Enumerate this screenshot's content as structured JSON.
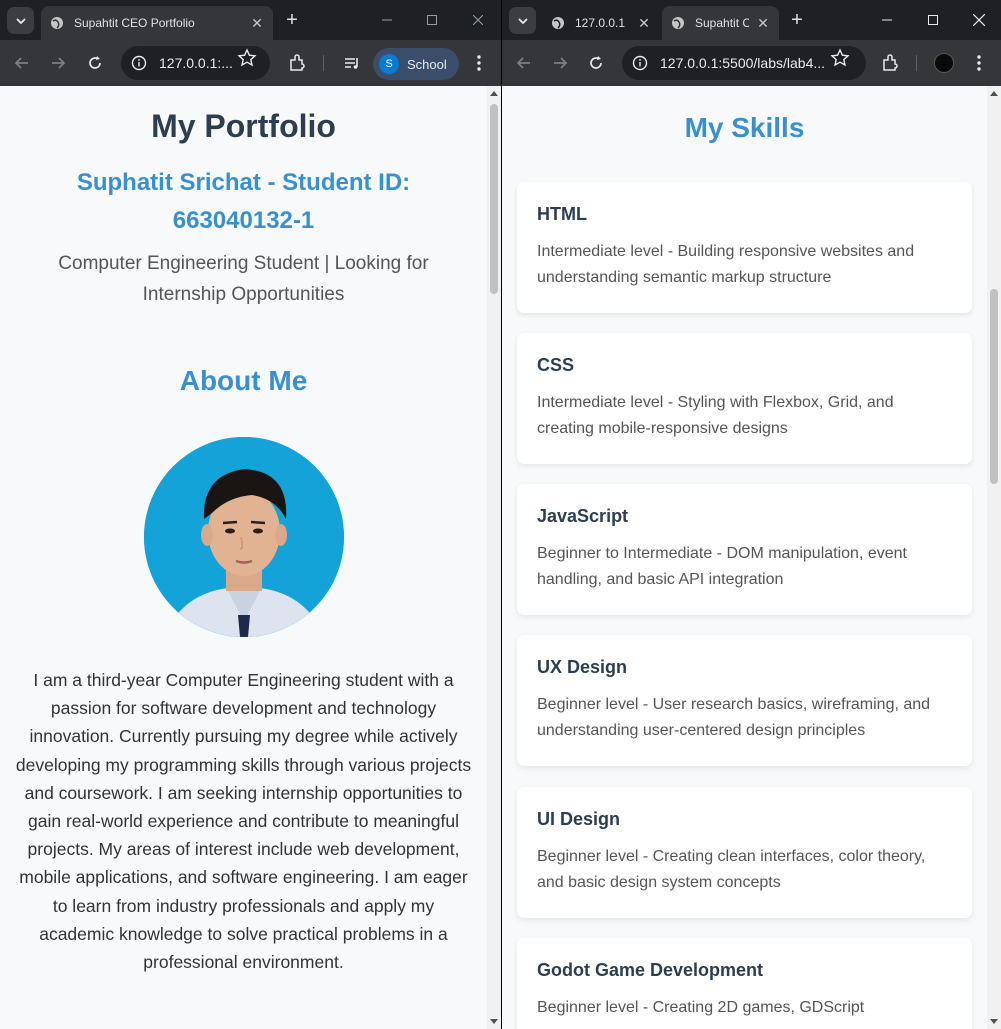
{
  "left_window": {
    "tab_title": "Supahtit CEO Portfolio",
    "url": "127.0.0.1:...",
    "profile_label": "School",
    "profile_initial": "S"
  },
  "right_window": {
    "tab1_title": "127.0.0.1",
    "tab2_title": "Supahtit C",
    "url": "127.0.0.1:5500/labs/lab4..."
  },
  "portfolio": {
    "heading": "My Portfolio",
    "name_line": "Suphatit Srichat - Student ID: 663040132-1",
    "tagline": "Computer Engineering Student | Looking for Internship Opportunities",
    "about_heading": "About Me",
    "about_text": "I am a third-year Computer Engineering student with a passion for software development and technology innovation. Currently pursuing my degree while actively developing my programming skills through various projects and coursework. I am seeking internship opportunities to gain real-world experience and contribute to meaningful projects. My areas of interest include web development, mobile applications, and software engineering. I am eager to learn from industry professionals and apply my academic knowledge to solve practical problems in a professional environment."
  },
  "skills": {
    "heading": "My Skills",
    "items": [
      {
        "title": "HTML",
        "desc": "Intermediate level - Building responsive websites and understanding semantic markup structure"
      },
      {
        "title": "CSS",
        "desc": "Intermediate level - Styling with Flexbox, Grid, and creating mobile-responsive designs"
      },
      {
        "title": "JavaScript",
        "desc": "Beginner to Intermediate - DOM manipulation, event handling, and basic API integration"
      },
      {
        "title": "UX Design",
        "desc": "Beginner level - User research basics, wireframing, and understanding user-centered design principles"
      },
      {
        "title": "UI Design",
        "desc": "Beginner level - Creating clean interfaces, color theory, and basic design system concepts"
      },
      {
        "title": "Godot Game Development",
        "desc": "Beginner level - Creating 2D games, GDScript"
      }
    ]
  }
}
